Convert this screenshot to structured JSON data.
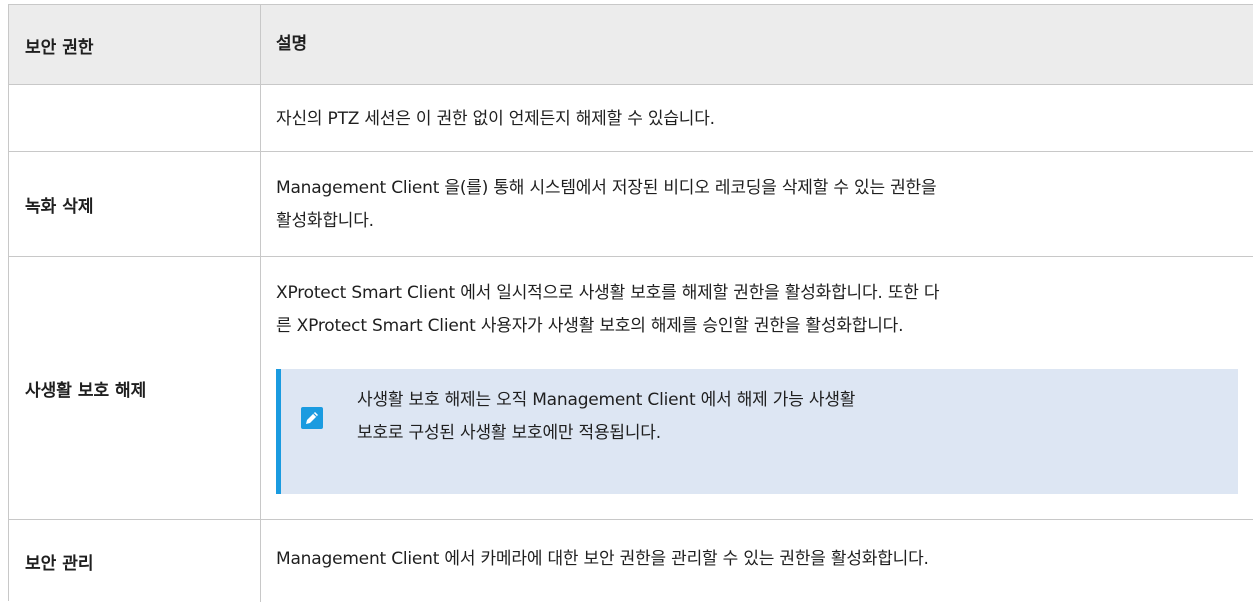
{
  "table": {
    "headers": {
      "left": "보안 권한",
      "right": "설명"
    },
    "rows": [
      {
        "permission": "",
        "description_lines": [
          "자신의 PTZ 세션은 이 권한 없이 언제든지 해제할 수 있습니다."
        ]
      },
      {
        "permission": "녹화 삭제",
        "description_lines": [
          "Management Client 을(를) 통해 시스템에서 저장된 비디오 레코딩을 삭제할 수 있는 권한을",
          "활성화합니다."
        ]
      },
      {
        "permission": "사생활 보호 해제",
        "description_lines": [
          "XProtect Smart Client 에서 일시적으로 사생활 보호를 해제할 권한을 활성화합니다. 또한 다",
          "른 XProtect Smart Client 사용자가 사생활 보호의 해제를 승인할 권한을 활성화합니다."
        ],
        "note": {
          "icon": "pencil-icon",
          "lines": [
            "사생활 보호 해제는 오직 Management Client 에서 해제 가능 사생활",
            "보호로 구성된 사생활 보호에만 적용됩니다."
          ]
        }
      },
      {
        "permission": "보안 관리",
        "description_lines": [
          "Management Client 에서 카메라에 대한 보안 권한을 관리할 수 있는 권한을 활성화합니다."
        ]
      }
    ]
  },
  "colors": {
    "header_bg": "#ececec",
    "note_bg": "#dde6f3",
    "note_accent": "#1a9be0",
    "border": "#c8c8c8"
  }
}
